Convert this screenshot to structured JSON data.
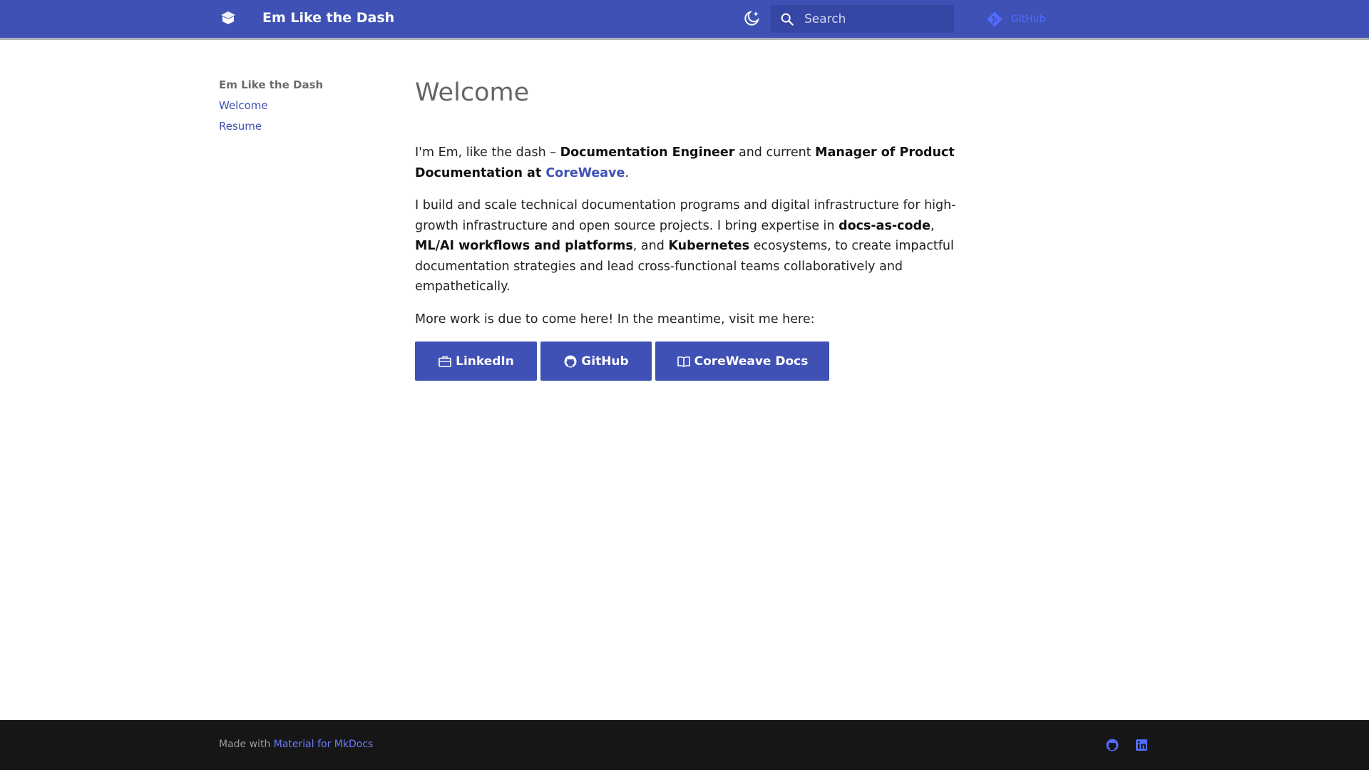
{
  "header": {
    "site_title": "Em Like the Dash",
    "logo_icon": "book-open-icon",
    "theme_icon": "moon-sun-icon",
    "search_placeholder": "Search",
    "repo_label": "GitHub",
    "repo_icon": "git-icon",
    "color": "#4051b5"
  },
  "sidebar": {
    "title": "Em Like the Dash",
    "items": [
      {
        "label": "Welcome"
      },
      {
        "label": "Resume"
      }
    ]
  },
  "main": {
    "title": "Welcome",
    "p1": {
      "t1": "I'm Em, like the dash – ",
      "b1": "Documentation Engineer",
      "t2": " and current ",
      "b2": "Manager of Product Documentation at ",
      "link": "CoreWeave",
      "t3": "."
    },
    "p2": {
      "t1": "I build and scale technical documentation programs and digital infrastructure for high-growth infrastructure and open source projects. I bring expertise in ",
      "b1": "docs-as-code",
      "t2": ", ",
      "b2": "ML/AI workflows and platforms",
      "t3": ", and ",
      "b3": "Kubernetes",
      "t4": " ecosystems, to create impactful documentation strategies and lead cross-functional teams collaboratively and empathetically."
    },
    "p3": "More work is due to come here! In the meantime, visit me here:",
    "buttons": [
      {
        "label": "LinkedIn",
        "icon": "briefcase-icon"
      },
      {
        "label": "GitHub",
        "icon": "github-icon"
      },
      {
        "label": "CoreWeave Docs",
        "icon": "book-icon"
      }
    ]
  },
  "footer": {
    "made_with": "Made with ",
    "made_with_link": "Material for MkDocs",
    "social": [
      {
        "icon": "github-icon"
      },
      {
        "icon": "linkedin-icon"
      }
    ]
  }
}
